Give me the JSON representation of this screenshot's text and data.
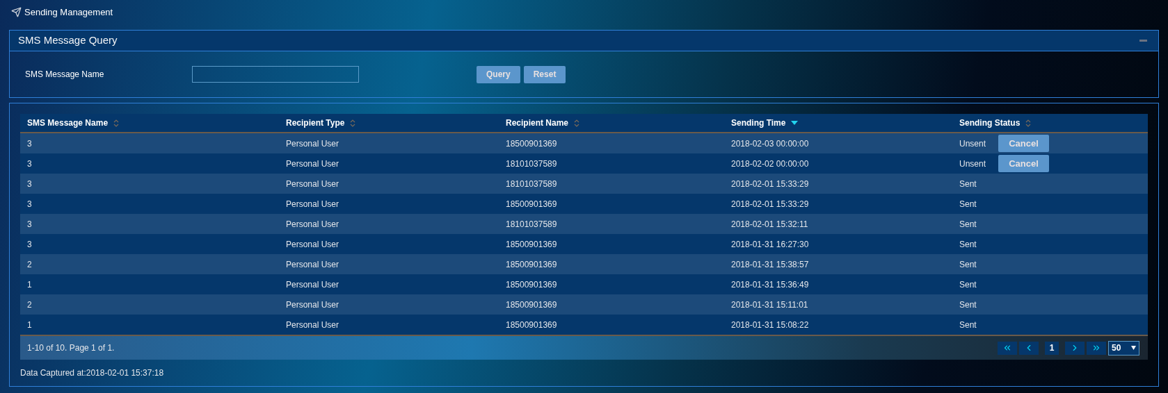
{
  "breadcrumb": {
    "title": "Sending Management"
  },
  "query_panel": {
    "title": "SMS Message Query",
    "field_label": "SMS Message Name",
    "buttons": [
      "Query",
      "Reset"
    ]
  },
  "table": {
    "columns": [
      {
        "label": "SMS Message Name",
        "sorted": false
      },
      {
        "label": "Recipient Type",
        "sorted": false
      },
      {
        "label": "Recipient Name",
        "sorted": false
      },
      {
        "label": "Sending Time",
        "sorted": true
      },
      {
        "label": "Sending Status",
        "sorted": false
      }
    ],
    "rows": [
      {
        "cells": [
          "3",
          "Personal User",
          "18500901369",
          "2018-02-03 00:00:00",
          "Unsent"
        ],
        "action": "Cancel"
      },
      {
        "cells": [
          "3",
          "Personal User",
          "18101037589",
          "2018-02-02 00:00:00",
          "Unsent"
        ],
        "action": "Cancel"
      },
      {
        "cells": [
          "3",
          "Personal User",
          "18101037589",
          "2018-02-01 15:33:29",
          "Sent"
        ]
      },
      {
        "cells": [
          "3",
          "Personal User",
          "18500901369",
          "2018-02-01 15:33:29",
          "Sent"
        ]
      },
      {
        "cells": [
          "3",
          "Personal User",
          "18101037589",
          "2018-02-01 15:32:11",
          "Sent"
        ]
      },
      {
        "cells": [
          "3",
          "Personal User",
          "18500901369",
          "2018-01-31 16:27:30",
          "Sent"
        ]
      },
      {
        "cells": [
          "2",
          "Personal User",
          "18500901369",
          "2018-01-31 15:38:57",
          "Sent"
        ]
      },
      {
        "cells": [
          "1",
          "Personal User",
          "18500901369",
          "2018-01-31 15:36:49",
          "Sent"
        ]
      },
      {
        "cells": [
          "2",
          "Personal User",
          "18500901369",
          "2018-01-31 15:11:01",
          "Sent"
        ]
      },
      {
        "cells": [
          "1",
          "Personal User",
          "18500901369",
          "2018-01-31 15:08:22",
          "Sent"
        ]
      }
    ]
  },
  "pagination": {
    "summary": "1-10 of 10. Page 1 of 1.",
    "current_page": "1",
    "page_size": "50"
  },
  "footer": {
    "captured": "Data Captured at:2018-02-01 15:37:18"
  }
}
